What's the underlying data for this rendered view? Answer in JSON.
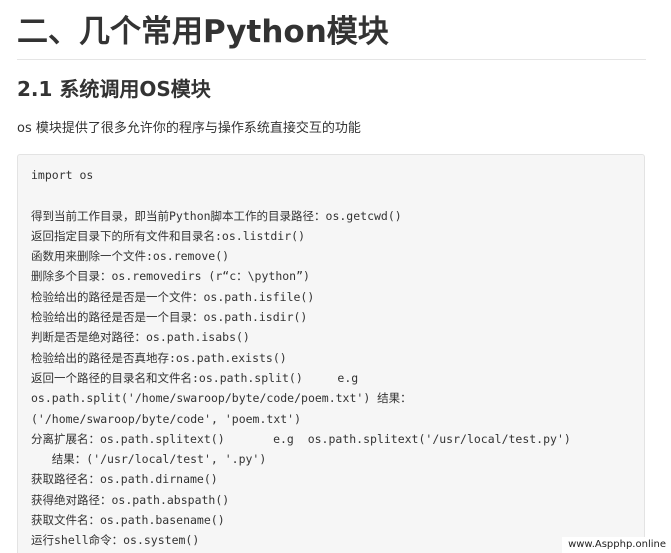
{
  "heading": "二、几个常用Python模块",
  "subheading": "2.1 系统调用OS模块",
  "intro": "os 模块提供了很多允许你的程序与操作系统直接交互的功能",
  "code_lines": [
    "import os",
    "",
    "得到当前工作目录，即当前Python脚本工作的目录路径：os.getcwd()",
    "返回指定目录下的所有文件和目录名:os.listdir()",
    "函数用来删除一个文件:os.remove()",
    "删除多个目录：os.removedirs (r“c：\\python”)",
    "检验给出的路径是否是一个文件：os.path.isfile()",
    "检验给出的路径是否是一个目录：os.path.isdir()",
    "判断是否是绝对路径：os.path.isabs()",
    "检验给出的路径是否真地存:os.path.exists()",
    "返回一个路径的目录名和文件名:os.path.split()     e.g",
    "os.path.split('/home/swaroop/byte/code/poem.txt') 结果：",
    "('/home/swaroop/byte/code', 'poem.txt')",
    "分离扩展名：os.path.splitext()       e.g  os.path.splitext('/usr/local/test.py')",
    "   结果：('/usr/local/test', '.py')",
    "获取路径名：os.path.dirname()",
    "获得绝对路径：os.path.abspath()",
    "获取文件名：os.path.basename()",
    "运行shell命令：os.system()"
  ],
  "watermark": "www.Aspphp.online"
}
